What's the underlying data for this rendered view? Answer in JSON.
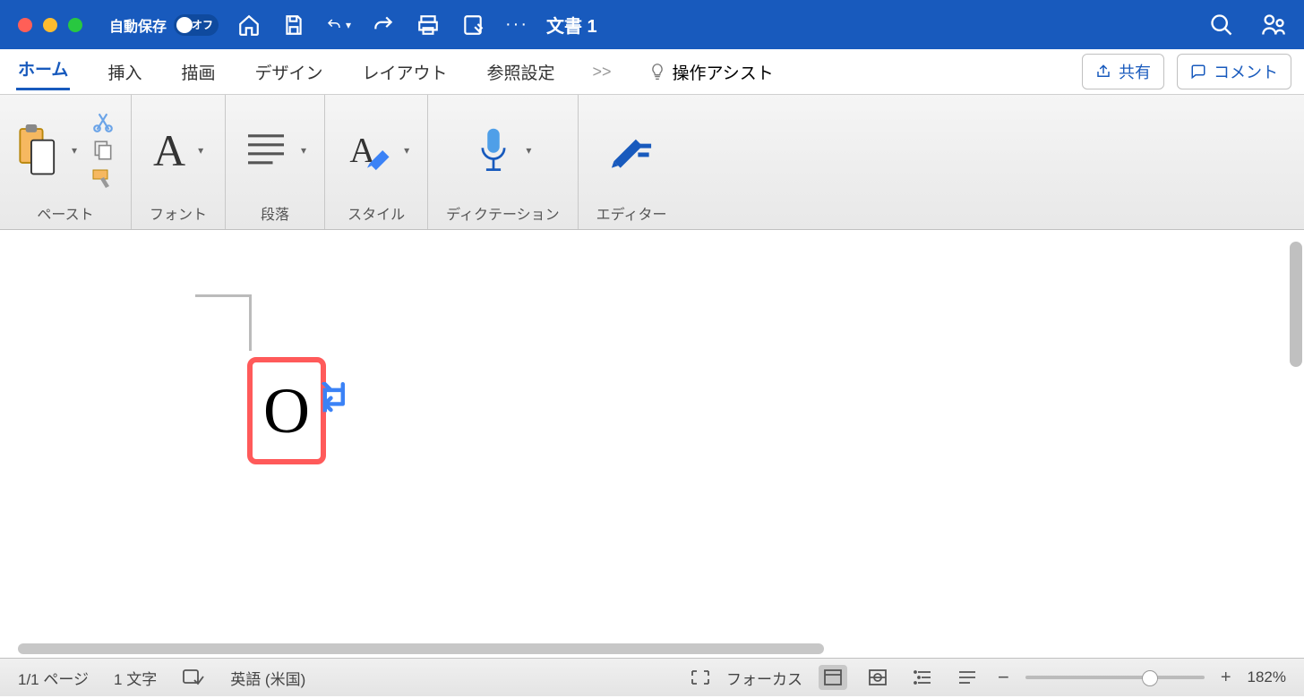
{
  "colors": {
    "accent": "#185ABD",
    "close": "#FF5F57",
    "min": "#FEBC2E",
    "max": "#28C840",
    "highlight": "#FF5A5A",
    "paramark": "#3b82f6"
  },
  "titlebar": {
    "autosave_label": "自動保存",
    "autosave_state": "オフ",
    "doc_title": "文書 1"
  },
  "tabs": {
    "items": [
      "ホーム",
      "挿入",
      "描画",
      "デザイン",
      "レイアウト",
      "参照設定"
    ],
    "more": ">>",
    "assist": "操作アシスト",
    "share": "共有",
    "comment": "コメント"
  },
  "ribbon": {
    "paste": "ペースト",
    "font": "フォント",
    "paragraph": "段落",
    "style": "スタイル",
    "dictation": "ディクテーション",
    "editor": "エディター"
  },
  "document": {
    "selected_char": "O"
  },
  "status": {
    "page": "1/1 ページ",
    "chars": "1 文字",
    "language": "英語 (米国)",
    "focus": "フォーカス",
    "zoom": "182%",
    "zoom_minus": "−",
    "zoom_plus": "+"
  }
}
